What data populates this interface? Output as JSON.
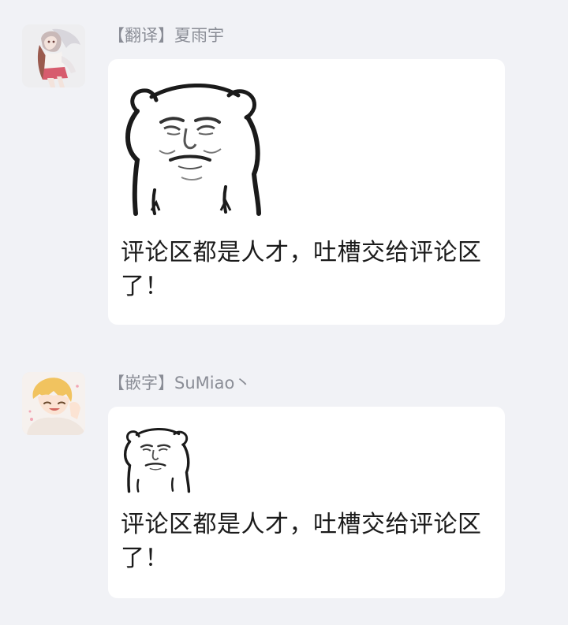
{
  "messages": [
    {
      "sender": "【翻译】夏雨宇",
      "text": "评论区都是人才，吐槽交给评论区了！",
      "avatar_icon": "anime-girl-avatar-icon",
      "sticker_icon": "bear-meme-sticker-icon",
      "sticker_size": "large"
    },
    {
      "sender": "【嵌字】SuMiao丶",
      "text": "评论区都是人才，吐槽交给评论区了！",
      "avatar_icon": "anime-boy-avatar-icon",
      "sticker_icon": "bear-meme-sticker-icon",
      "sticker_size": "small"
    }
  ],
  "colors": {
    "background": "#f1f2f6",
    "bubble": "#ffffff",
    "sender_text": "#8a8d96",
    "message_text": "#1b1b1b"
  }
}
